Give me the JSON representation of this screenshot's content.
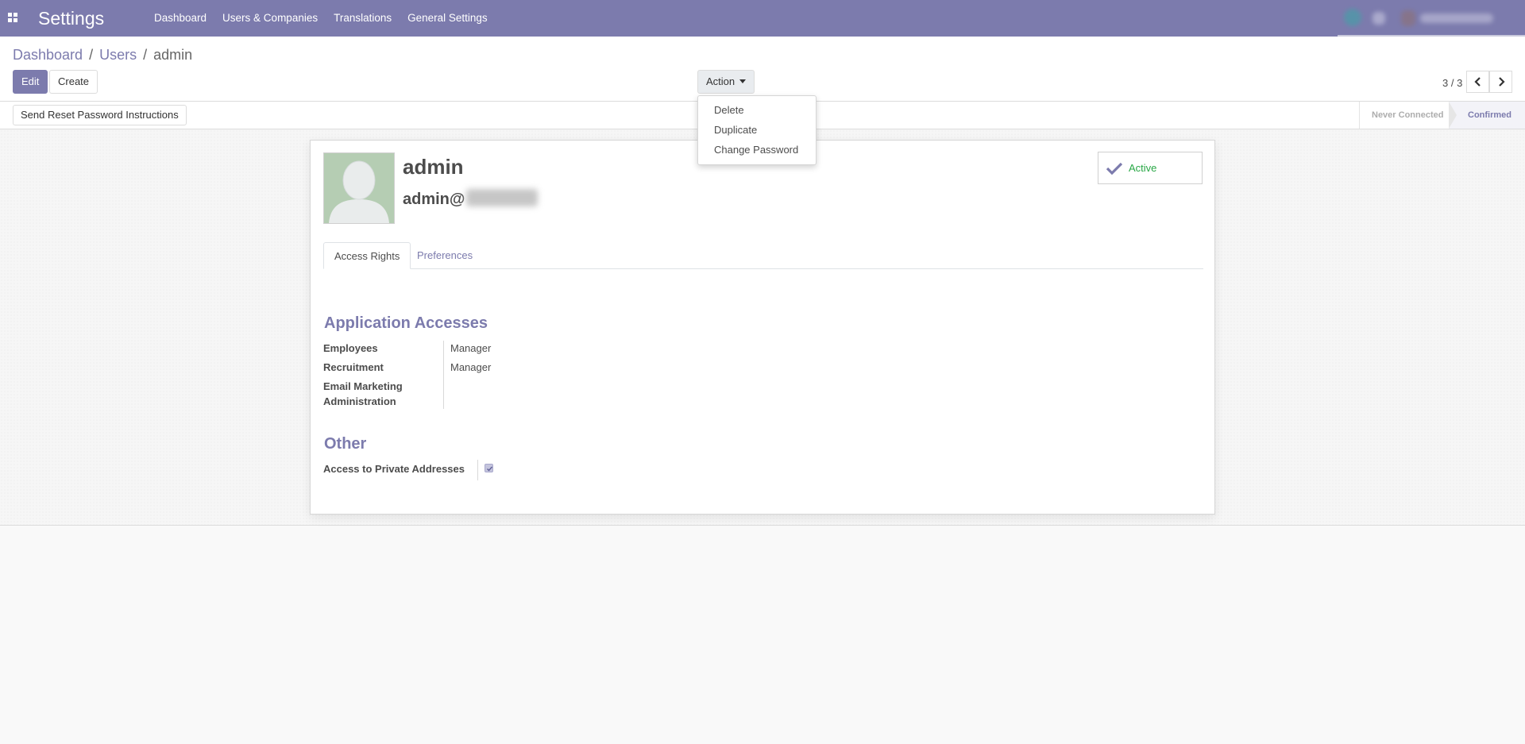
{
  "navbar": {
    "brand": "Settings",
    "menu": [
      "Dashboard",
      "Users & Companies",
      "Translations",
      "General Settings"
    ]
  },
  "breadcrumb": {
    "items": [
      "Dashboard",
      "Users"
    ],
    "current": "admin",
    "separator": "/"
  },
  "toolbar": {
    "edit_label": "Edit",
    "create_label": "Create",
    "action_label": "Action",
    "pager": "3 / 3"
  },
  "action_menu": {
    "items": [
      "Delete",
      "Duplicate",
      "Change Password"
    ]
  },
  "statusbar": {
    "reset_button": "Send Reset Password Instructions",
    "stages": [
      "Never Connected",
      "Confirmed"
    ],
    "current_stage": "Confirmed"
  },
  "user": {
    "name": "admin",
    "login_prefix": "admin@",
    "active_label": "Active"
  },
  "tabs": [
    "Access Rights",
    "Preferences"
  ],
  "access": {
    "section_title": "Application Accesses",
    "fields": [
      {
        "label": "Employees",
        "value": "Manager"
      },
      {
        "label": "Recruitment",
        "value": "Manager"
      },
      {
        "label": "Email Marketing Administration",
        "value": ""
      }
    ]
  },
  "other": {
    "section_title": "Other",
    "fields": [
      {
        "label": "Access to Private Addresses",
        "checked": true
      }
    ]
  },
  "colors": {
    "brand": "#7c7bad",
    "active_green": "#28a745"
  }
}
